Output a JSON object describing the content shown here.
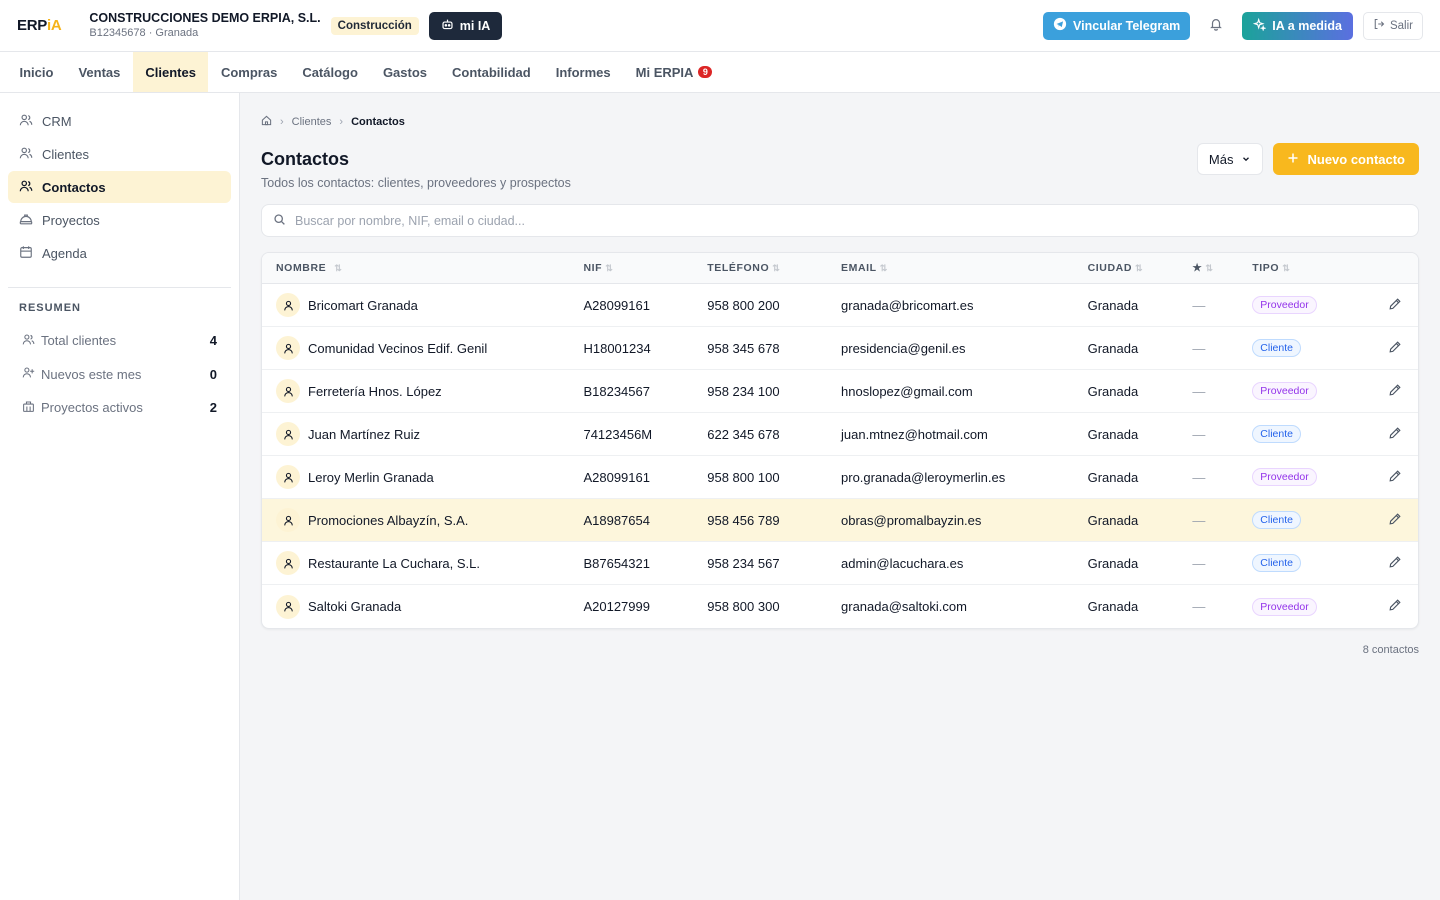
{
  "header": {
    "logo_main": "ERP",
    "logo_accent": "iA",
    "company_name": "CONSTRUCCIONES DEMO ERPIA, S.L.",
    "company_sub": "B12345678 · Granada",
    "sector": "Construcción",
    "mi_ia": "mi IA",
    "telegram": "Vincular Telegram",
    "ia_medida": "IA a medida",
    "salir": "Salir"
  },
  "nav": {
    "tabs": [
      {
        "label": "Inicio"
      },
      {
        "label": "Ventas"
      },
      {
        "label": "Clientes"
      },
      {
        "label": "Compras"
      },
      {
        "label": "Catálogo"
      },
      {
        "label": "Gastos"
      },
      {
        "label": "Contabilidad"
      },
      {
        "label": "Informes"
      },
      {
        "label": "Mi ERPIA"
      }
    ],
    "active": "Clientes",
    "mi_erpia_badge": "9"
  },
  "sidebar": {
    "items": [
      {
        "label": "CRM"
      },
      {
        "label": "Clientes"
      },
      {
        "label": "Contactos"
      },
      {
        "label": "Proyectos"
      },
      {
        "label": "Agenda"
      }
    ],
    "summary_heading": "RESUMEN",
    "stats": [
      {
        "label": "Total clientes",
        "value": "4"
      },
      {
        "label": "Nuevos este mes",
        "value": "0"
      },
      {
        "label": "Proyectos activos",
        "value": "2"
      }
    ]
  },
  "breadcrumb": {
    "parent": "Clientes",
    "current": "Contactos"
  },
  "page": {
    "title": "Contactos",
    "subtitle": "Todos los contactos: clientes, proveedores y prospectos",
    "more_button": "Más",
    "new_button": "Nuevo contacto"
  },
  "search": {
    "placeholder": "Buscar por nombre, NIF, email o ciudad..."
  },
  "table": {
    "headers": {
      "name": "NOMBRE",
      "nif": "NIF",
      "phone": "TELÉFONO",
      "email": "EMAIL",
      "city": "CIUDAD",
      "star": "★",
      "type": "TIPO"
    },
    "rows": [
      {
        "name": "Bricomart Granada",
        "nif": "A28099161",
        "phone": "958 800 200",
        "email": "granada@bricomart.es",
        "city": "Granada",
        "star": "—",
        "type": "Proveedor"
      },
      {
        "name": "Comunidad Vecinos Edif. Genil",
        "nif": "H18001234",
        "phone": "958 345 678",
        "email": "presidencia@genil.es",
        "city": "Granada",
        "star": "—",
        "type": "Cliente"
      },
      {
        "name": "Ferretería Hnos. López",
        "nif": "B18234567",
        "phone": "958 234 100",
        "email": "hnoslopez@gmail.com",
        "city": "Granada",
        "star": "—",
        "type": "Proveedor"
      },
      {
        "name": "Juan Martínez Ruiz",
        "nif": "74123456M",
        "phone": "622 345 678",
        "email": "juan.mtnez@hotmail.com",
        "city": "Granada",
        "star": "—",
        "type": "Cliente"
      },
      {
        "name": "Leroy Merlin Granada",
        "nif": "A28099161",
        "phone": "958 800 100",
        "email": "pro.granada@leroymerlin.es",
        "city": "Granada",
        "star": "—",
        "type": "Proveedor"
      },
      {
        "name": "Promociones Albayzín, S.A.",
        "nif": "A18987654",
        "phone": "958 456 789",
        "email": "obras@promalbayzin.es",
        "city": "Granada",
        "star": "—",
        "type": "Cliente"
      },
      {
        "name": "Restaurante La Cuchara, S.L.",
        "nif": "B87654321",
        "phone": "958 234 567",
        "email": "admin@lacuchara.es",
        "city": "Granada",
        "star": "—",
        "type": "Cliente"
      },
      {
        "name": "Saltoki Granada",
        "nif": "A20127999",
        "phone": "958 800 300",
        "email": "granada@saltoki.com",
        "city": "Granada",
        "star": "—",
        "type": "Proveedor"
      }
    ],
    "highlighted_row": 5
  },
  "footer": {
    "count": "8 contactos"
  },
  "colors": {
    "accent": "#f8b81e",
    "accent_soft": "#fdf3d4",
    "telegram": "#3ba0dc",
    "dark": "#1e293b"
  }
}
